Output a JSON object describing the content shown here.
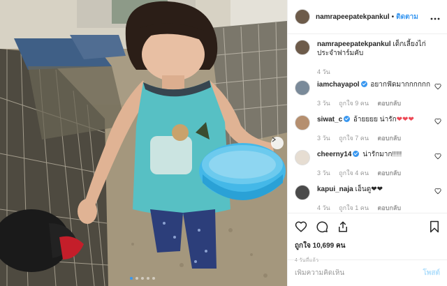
{
  "colors": {
    "link": "#3897f0",
    "heart": "#ed4956",
    "muted": "#999999",
    "post_disabled": "#b2dffc"
  },
  "header": {
    "username": "namrapeepatekpankul",
    "separator": "•",
    "follow_label": "ติดตาม",
    "more_icon": "more-horizontal-icon"
  },
  "caption": {
    "username": "namrapeepatekpankul",
    "text": "เด็กเลี้ยงไก่ประจำฟาร์มคับ",
    "time": "4 วัน"
  },
  "comments": [
    {
      "username": "iamchayapol",
      "verified": true,
      "text": "อยากฟัดมากกกกกก",
      "time": "3 วัน",
      "likes": "ถูกใจ 9 คน",
      "reply": "ตอบกลับ"
    },
    {
      "username": "siwat_c",
      "verified": true,
      "text": "อ้ายยยย น่ารัก",
      "hearts": "❤❤❤",
      "time": "3 วัน",
      "likes": "ถูกใจ 7 คน",
      "reply": "ตอบกลับ"
    },
    {
      "username": "cheerny14",
      "verified": true,
      "text": "น่ารักมาก!!!!!",
      "time": "3 วัน",
      "likes": "ถูกใจ 4 คน",
      "reply": "ตอบกลับ"
    },
    {
      "username": "kapui_naja",
      "verified": false,
      "text": "เอ็นดู",
      "hearts": "❤❤",
      "time": "4 วัน",
      "likes": "ถูกใจ 1 คน",
      "reply": "ตอบกลับ"
    }
  ],
  "actions": {
    "like_icon": "heart-icon",
    "comment_icon": "comment-icon",
    "share_icon": "share-icon",
    "save_icon": "bookmark-icon",
    "likes_text": "ถูกใจ 10,699 คน",
    "posted_ago": "4 วันที่แล้ว"
  },
  "add_comment": {
    "placeholder": "เพิ่มความคิดเห็น",
    "post_label": "โพสต์"
  },
  "carousel": {
    "slide_count": 5,
    "active_index": 0
  }
}
